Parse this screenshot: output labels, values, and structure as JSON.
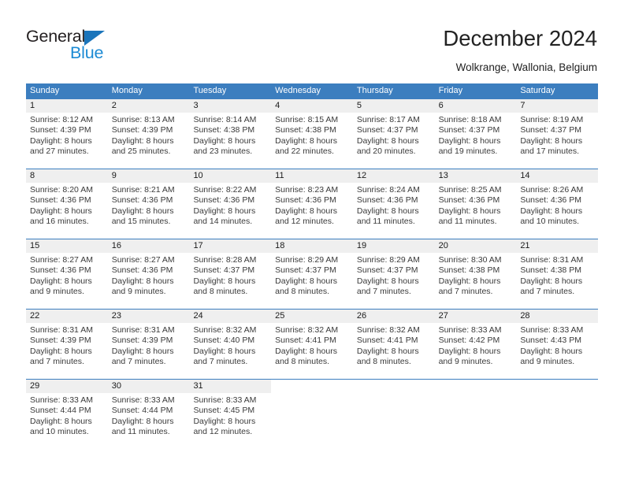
{
  "branding": {
    "logo_text_1": "General",
    "logo_text_2": "Blue",
    "logo_colors": {
      "dark": "#231f20",
      "blue": "#1b8ad4",
      "triangle": "#1b75bb"
    }
  },
  "header": {
    "title": "December 2024",
    "subtitle": "Wolkrange, Wallonia, Belgium"
  },
  "theme": {
    "header_band": "#3c7ebf",
    "daynum_strip": "#efefef",
    "rule": "#3c7ebf",
    "text": "#3a3a3a"
  },
  "weekday_headers": [
    "Sunday",
    "Monday",
    "Tuesday",
    "Wednesday",
    "Thursday",
    "Friday",
    "Saturday"
  ],
  "weeks": [
    [
      {
        "day": "1",
        "sunrise": "Sunrise: 8:12 AM",
        "sunset": "Sunset: 4:39 PM",
        "daylight1": "Daylight: 8 hours",
        "daylight2": "and 27 minutes."
      },
      {
        "day": "2",
        "sunrise": "Sunrise: 8:13 AM",
        "sunset": "Sunset: 4:39 PM",
        "daylight1": "Daylight: 8 hours",
        "daylight2": "and 25 minutes."
      },
      {
        "day": "3",
        "sunrise": "Sunrise: 8:14 AM",
        "sunset": "Sunset: 4:38 PM",
        "daylight1": "Daylight: 8 hours",
        "daylight2": "and 23 minutes."
      },
      {
        "day": "4",
        "sunrise": "Sunrise: 8:15 AM",
        "sunset": "Sunset: 4:38 PM",
        "daylight1": "Daylight: 8 hours",
        "daylight2": "and 22 minutes."
      },
      {
        "day": "5",
        "sunrise": "Sunrise: 8:17 AM",
        "sunset": "Sunset: 4:37 PM",
        "daylight1": "Daylight: 8 hours",
        "daylight2": "and 20 minutes."
      },
      {
        "day": "6",
        "sunrise": "Sunrise: 8:18 AM",
        "sunset": "Sunset: 4:37 PM",
        "daylight1": "Daylight: 8 hours",
        "daylight2": "and 19 minutes."
      },
      {
        "day": "7",
        "sunrise": "Sunrise: 8:19 AM",
        "sunset": "Sunset: 4:37 PM",
        "daylight1": "Daylight: 8 hours",
        "daylight2": "and 17 minutes."
      }
    ],
    [
      {
        "day": "8",
        "sunrise": "Sunrise: 8:20 AM",
        "sunset": "Sunset: 4:36 PM",
        "daylight1": "Daylight: 8 hours",
        "daylight2": "and 16 minutes."
      },
      {
        "day": "9",
        "sunrise": "Sunrise: 8:21 AM",
        "sunset": "Sunset: 4:36 PM",
        "daylight1": "Daylight: 8 hours",
        "daylight2": "and 15 minutes."
      },
      {
        "day": "10",
        "sunrise": "Sunrise: 8:22 AM",
        "sunset": "Sunset: 4:36 PM",
        "daylight1": "Daylight: 8 hours",
        "daylight2": "and 14 minutes."
      },
      {
        "day": "11",
        "sunrise": "Sunrise: 8:23 AM",
        "sunset": "Sunset: 4:36 PM",
        "daylight1": "Daylight: 8 hours",
        "daylight2": "and 12 minutes."
      },
      {
        "day": "12",
        "sunrise": "Sunrise: 8:24 AM",
        "sunset": "Sunset: 4:36 PM",
        "daylight1": "Daylight: 8 hours",
        "daylight2": "and 11 minutes."
      },
      {
        "day": "13",
        "sunrise": "Sunrise: 8:25 AM",
        "sunset": "Sunset: 4:36 PM",
        "daylight1": "Daylight: 8 hours",
        "daylight2": "and 11 minutes."
      },
      {
        "day": "14",
        "sunrise": "Sunrise: 8:26 AM",
        "sunset": "Sunset: 4:36 PM",
        "daylight1": "Daylight: 8 hours",
        "daylight2": "and 10 minutes."
      }
    ],
    [
      {
        "day": "15",
        "sunrise": "Sunrise: 8:27 AM",
        "sunset": "Sunset: 4:36 PM",
        "daylight1": "Daylight: 8 hours",
        "daylight2": "and 9 minutes."
      },
      {
        "day": "16",
        "sunrise": "Sunrise: 8:27 AM",
        "sunset": "Sunset: 4:36 PM",
        "daylight1": "Daylight: 8 hours",
        "daylight2": "and 9 minutes."
      },
      {
        "day": "17",
        "sunrise": "Sunrise: 8:28 AM",
        "sunset": "Sunset: 4:37 PM",
        "daylight1": "Daylight: 8 hours",
        "daylight2": "and 8 minutes."
      },
      {
        "day": "18",
        "sunrise": "Sunrise: 8:29 AM",
        "sunset": "Sunset: 4:37 PM",
        "daylight1": "Daylight: 8 hours",
        "daylight2": "and 8 minutes."
      },
      {
        "day": "19",
        "sunrise": "Sunrise: 8:29 AM",
        "sunset": "Sunset: 4:37 PM",
        "daylight1": "Daylight: 8 hours",
        "daylight2": "and 7 minutes."
      },
      {
        "day": "20",
        "sunrise": "Sunrise: 8:30 AM",
        "sunset": "Sunset: 4:38 PM",
        "daylight1": "Daylight: 8 hours",
        "daylight2": "and 7 minutes."
      },
      {
        "day": "21",
        "sunrise": "Sunrise: 8:31 AM",
        "sunset": "Sunset: 4:38 PM",
        "daylight1": "Daylight: 8 hours",
        "daylight2": "and 7 minutes."
      }
    ],
    [
      {
        "day": "22",
        "sunrise": "Sunrise: 8:31 AM",
        "sunset": "Sunset: 4:39 PM",
        "daylight1": "Daylight: 8 hours",
        "daylight2": "and 7 minutes."
      },
      {
        "day": "23",
        "sunrise": "Sunrise: 8:31 AM",
        "sunset": "Sunset: 4:39 PM",
        "daylight1": "Daylight: 8 hours",
        "daylight2": "and 7 minutes."
      },
      {
        "day": "24",
        "sunrise": "Sunrise: 8:32 AM",
        "sunset": "Sunset: 4:40 PM",
        "daylight1": "Daylight: 8 hours",
        "daylight2": "and 7 minutes."
      },
      {
        "day": "25",
        "sunrise": "Sunrise: 8:32 AM",
        "sunset": "Sunset: 4:41 PM",
        "daylight1": "Daylight: 8 hours",
        "daylight2": "and 8 minutes."
      },
      {
        "day": "26",
        "sunrise": "Sunrise: 8:32 AM",
        "sunset": "Sunset: 4:41 PM",
        "daylight1": "Daylight: 8 hours",
        "daylight2": "and 8 minutes."
      },
      {
        "day": "27",
        "sunrise": "Sunrise: 8:33 AM",
        "sunset": "Sunset: 4:42 PM",
        "daylight1": "Daylight: 8 hours",
        "daylight2": "and 9 minutes."
      },
      {
        "day": "28",
        "sunrise": "Sunrise: 8:33 AM",
        "sunset": "Sunset: 4:43 PM",
        "daylight1": "Daylight: 8 hours",
        "daylight2": "and 9 minutes."
      }
    ],
    [
      {
        "day": "29",
        "sunrise": "Sunrise: 8:33 AM",
        "sunset": "Sunset: 4:44 PM",
        "daylight1": "Daylight: 8 hours",
        "daylight2": "and 10 minutes."
      },
      {
        "day": "30",
        "sunrise": "Sunrise: 8:33 AM",
        "sunset": "Sunset: 4:44 PM",
        "daylight1": "Daylight: 8 hours",
        "daylight2": "and 11 minutes."
      },
      {
        "day": "31",
        "sunrise": "Sunrise: 8:33 AM",
        "sunset": "Sunset: 4:45 PM",
        "daylight1": "Daylight: 8 hours",
        "daylight2": "and 12 minutes."
      },
      {
        "day": "",
        "sunrise": "",
        "sunset": "",
        "daylight1": "",
        "daylight2": ""
      },
      {
        "day": "",
        "sunrise": "",
        "sunset": "",
        "daylight1": "",
        "daylight2": ""
      },
      {
        "day": "",
        "sunrise": "",
        "sunset": "",
        "daylight1": "",
        "daylight2": ""
      },
      {
        "day": "",
        "sunrise": "",
        "sunset": "",
        "daylight1": "",
        "daylight2": ""
      }
    ]
  ]
}
